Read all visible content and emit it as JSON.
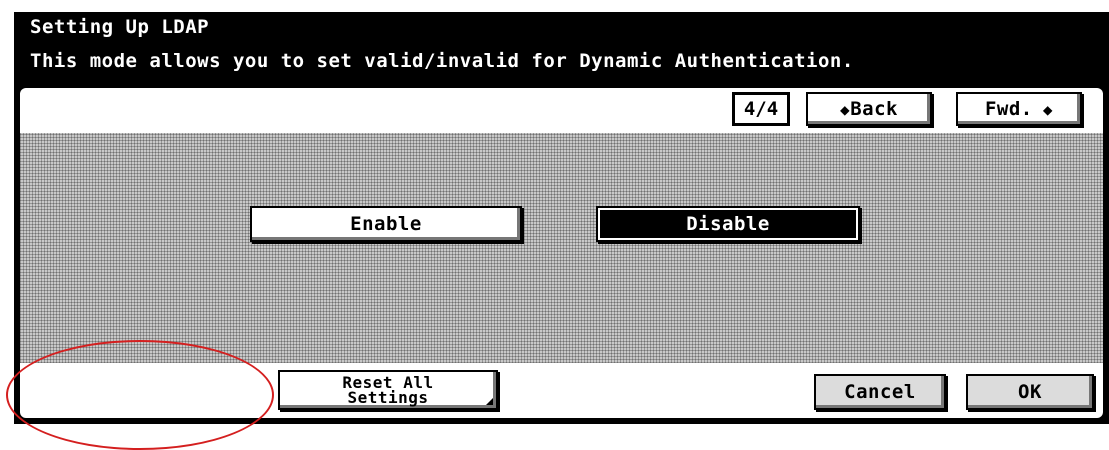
{
  "header": {
    "title": "Setting Up LDAP",
    "subtitle": "This mode allows you to set valid/invalid for Dynamic Authentication."
  },
  "pager": {
    "page": "4/4",
    "back_label": "Back",
    "fwd_label": "Fwd.",
    "back_icon": "arrow-left-icon",
    "fwd_icon": "arrow-right-icon"
  },
  "options": {
    "enable_label": "Enable",
    "disable_label": "Disable",
    "selected": "Disable"
  },
  "footer": {
    "reset_label_line1": "Reset All",
    "reset_label_line2": "Settings",
    "cancel_label": "Cancel",
    "ok_label": "OK"
  },
  "colors": {
    "header_bg": "#000000",
    "header_text": "#ffffff",
    "annotation": "#d41f1f",
    "pattern_bg": "#c8c8c8"
  }
}
